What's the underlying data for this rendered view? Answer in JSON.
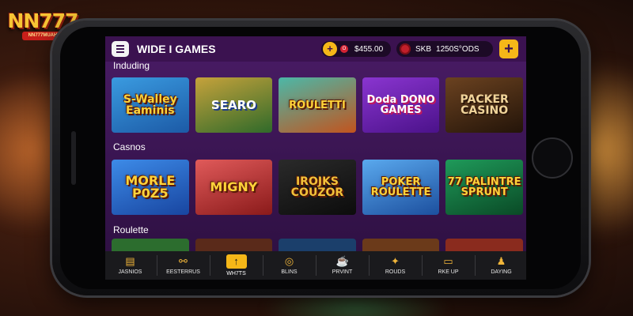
{
  "logo": {
    "text": "NN777",
    "sub": "NN777MUAH"
  },
  "header": {
    "title": "WIDE I GAMES",
    "balance_plus": "+",
    "balance_coin": "O",
    "balance_value": "$455.00",
    "chip_label": "SKB",
    "chip_value": "1250S°ODS",
    "add_label": "+"
  },
  "sections": [
    {
      "label": "Induding",
      "tiles": [
        {
          "text": "S-Walley Eaminis",
          "bg": "#1c6fc4"
        },
        {
          "text": "SEARO",
          "bg": "#2f6a2a"
        },
        {
          "text": "ROULETTI",
          "bg": "#1d7a6e"
        },
        {
          "text": "Doda DONO GAMES",
          "bg": "#6a1fa5"
        },
        {
          "text": "PACKER CASINO",
          "bg": "#3a2312"
        }
      ]
    },
    {
      "label": "Casnos",
      "tiles": [
        {
          "text": "MORLE P0Z5",
          "bg": "#2266c8"
        },
        {
          "text": "MIGNY",
          "bg": "#b12a2a"
        },
        {
          "text": "IROJKS COUZOR",
          "bg": "#141414"
        },
        {
          "text": "POKER ROULETTE",
          "bg": "#2a78c9"
        },
        {
          "text": "77 PALINTRE SPRUNT",
          "bg": "#0e6b3c"
        }
      ]
    },
    {
      "label": "Roulette",
      "tiles": [
        {
          "bg": "#2c6d2e"
        },
        {
          "bg": "#5a2a1a"
        },
        {
          "bg": "#1b3f6b"
        },
        {
          "bg": "#6b3a1a"
        },
        {
          "bg": "#8a2b1e"
        }
      ]
    }
  ],
  "nav": [
    {
      "label": "JASNIOS",
      "icon": "casino-icon",
      "glyph": "▤"
    },
    {
      "label": "EESTERRUS",
      "icon": "network-icon",
      "glyph": "⚯"
    },
    {
      "label": "WH7TS",
      "icon": "upload-icon",
      "glyph": "↑",
      "active": true
    },
    {
      "label": "BLINS",
      "icon": "chip-icon",
      "glyph": "◎"
    },
    {
      "label": "PRVINT",
      "icon": "cup-icon",
      "glyph": "☕"
    },
    {
      "label": "ROUDS",
      "icon": "sparkle-icon",
      "glyph": "✦"
    },
    {
      "label": "RKE UP",
      "icon": "screen-icon",
      "glyph": "▭"
    },
    {
      "label": "DAYING",
      "icon": "person-icon",
      "glyph": "♟"
    }
  ],
  "colors": {
    "accent": "#f5b718",
    "screen_bg": "#3a1552",
    "nav_bg": "#1a1a1d"
  }
}
